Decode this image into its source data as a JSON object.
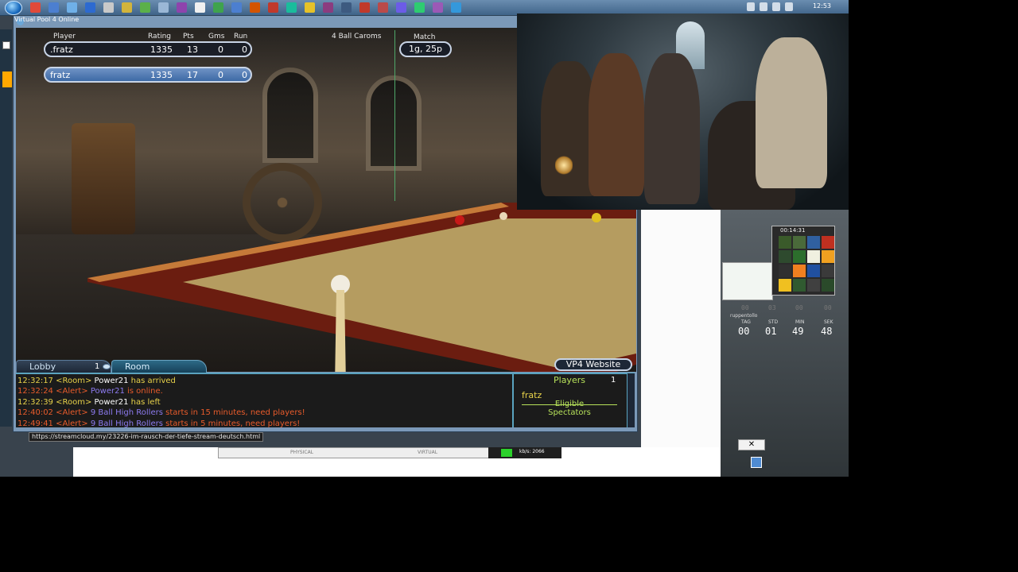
{
  "window": {
    "title": "Virtual Pool 4 Online"
  },
  "taskbar": {
    "clock": "12:53"
  },
  "scoreboard": {
    "headers": {
      "player": "Player",
      "rating": "Rating",
      "pts": "Pts",
      "gms": "Gms",
      "run": "Run"
    },
    "game_type": "4 Ball Caroms",
    "match_label": "Match",
    "match_value": "1g, 25p",
    "players": [
      {
        "name": ".fratz",
        "rating": "1335",
        "pts": "13",
        "gms": "0",
        "run": "0"
      },
      {
        "name": "fratz",
        "rating": "1335",
        "pts": "17",
        "gms": "0",
        "run": "0"
      }
    ]
  },
  "tabs": {
    "lobby": "Lobby",
    "lobby_count": "1",
    "room": "Room"
  },
  "website_button": "VP4 Website",
  "chat": [
    {
      "time": "12:32:17",
      "channel": "<Room>",
      "name": "Power21",
      "text": " has arrived",
      "kind": "room"
    },
    {
      "time": "12:32:24",
      "channel": "<Alert>",
      "name": "Power21",
      "text": " is online.",
      "kind": "alert"
    },
    {
      "time": "12:32:39",
      "channel": "<Room>",
      "name": "Power21",
      "text": " has left",
      "kind": "room"
    },
    {
      "time": "12:40:02",
      "channel": "<Alert>",
      "name": "9 Ball High Rollers",
      "text": " starts in 15 minutes, need players!",
      "kind": "alert"
    },
    {
      "time": "12:49:41",
      "channel": "<Alert>",
      "name": "9 Ball High Rollers",
      "text": " starts in 5 minutes, need players!",
      "kind": "alert"
    }
  ],
  "players_panel": {
    "header": "Players",
    "count": "1",
    "player": "fratz",
    "eligible": "Eligible",
    "spectators": "Spectators"
  },
  "url_tooltip": "https://streamcloud.my/23226-im-rausch-der-tiefe-stream-deutsch.html",
  "status_bar": {
    "physical": "PHYSICAL",
    "virtual": "VIRTUAL",
    "kbps": "kb/s: 2066"
  },
  "countdown": {
    "widget_time": "00:14:31",
    "labels": {
      "tag": "TAG",
      "std": "STD",
      "min": "MIN",
      "sek": "SEK"
    },
    "values": {
      "tag": "00",
      "std": "01",
      "min": "49",
      "sek": "48"
    },
    "dim_values": {
      "tag": "00",
      "std": "03",
      "min": "00",
      "sek": "00"
    },
    "owner": "ruppentollo"
  },
  "colors": {
    "timestamp": "#e8d24a",
    "alert": "#e85b2b",
    "name_alert": "#8d7bf0",
    "accent": "#5aa3bf"
  }
}
